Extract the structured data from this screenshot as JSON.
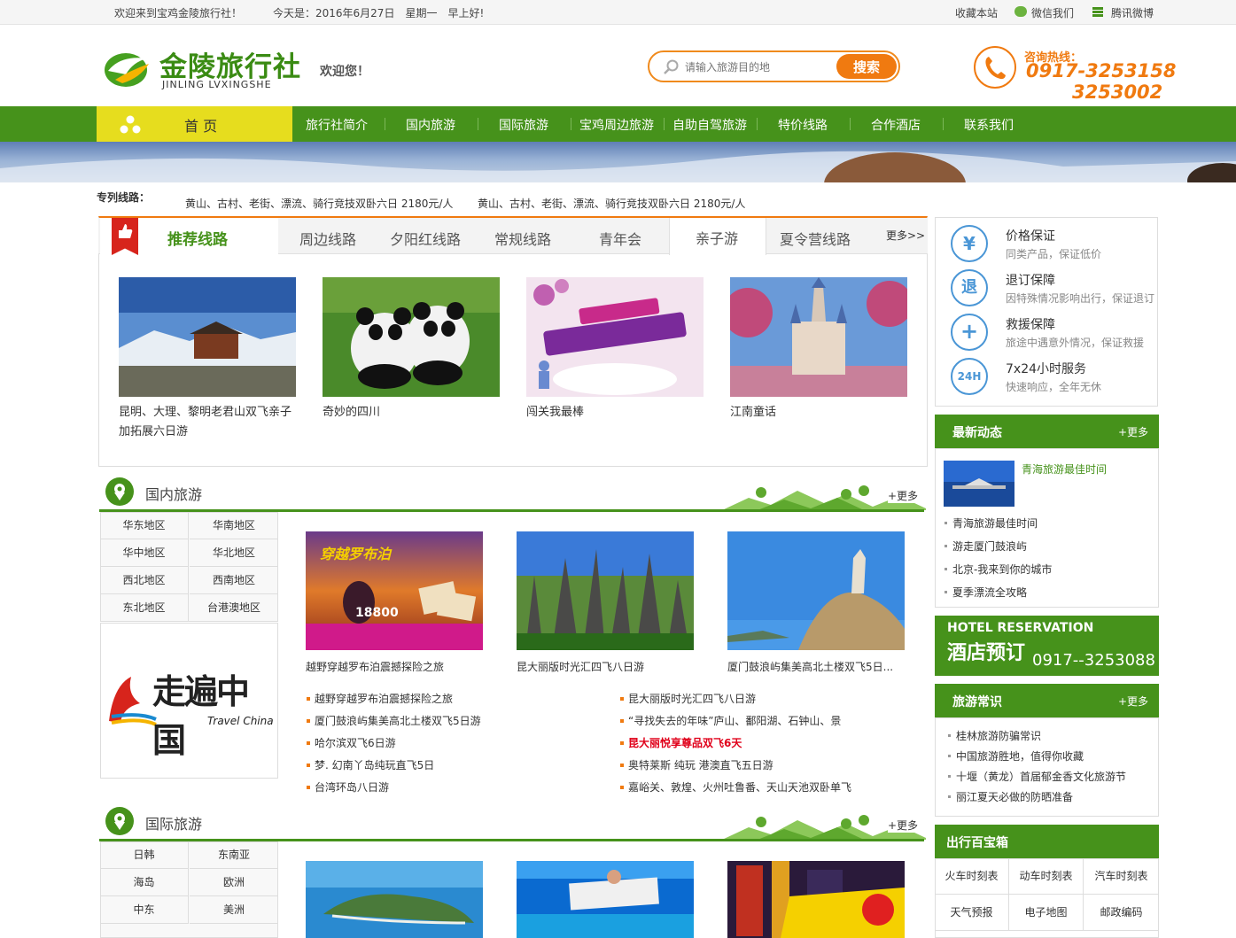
{
  "topbar": {
    "welcome": "欢迎来到宝鸡金陵旅行社！",
    "date": "今天是：2016年6月27日　星期一　早上好!",
    "favorite": "收藏本站",
    "wechat": "微信我们",
    "weibo": "腾讯微博"
  },
  "header": {
    "logo_cn": "金陵旅行社",
    "logo_en": "JINLING LVXINGSHE",
    "welcome": "欢迎您！",
    "search_placeholder": "请输入旅游目的地",
    "search_button": "搜索",
    "hotline_label": "咨询热线：",
    "hotline_1": "0917-3253158",
    "hotline_2": "3253002"
  },
  "nav": {
    "home": "首 页",
    "items": [
      "旅行社简介",
      "国内旅游",
      "国际旅游",
      "宝鸡周边旅游",
      "自助自驾旅游",
      "特价线路",
      "合作酒店",
      "联系我们"
    ]
  },
  "special": {
    "label": "专列线路：",
    "items": [
      "黄山、古村、老街、漂流、骑行竞技双卧六日 2180元/人",
      "黄山、古村、老街、漂流、骑行竞技双卧六日 2180元/人"
    ]
  },
  "recommend": {
    "title": "推荐线路",
    "tabs": [
      "周边线路",
      "夕阳红线路",
      "常规线路",
      "青年会",
      "亲子游",
      "夏令营线路"
    ],
    "more": "更多>>",
    "cards": [
      {
        "title": "昆明、大理、黎明老君山双飞亲子加拓展六日游"
      },
      {
        "title": "奇妙的四川"
      },
      {
        "title": "闯关我最棒"
      },
      {
        "title": "江南童话"
      }
    ]
  },
  "domestic": {
    "title": "国内旅游",
    "more": "+更多",
    "regions": [
      "华东地区",
      "华南地区",
      "华中地区",
      "华北地区",
      "西北地区",
      "西南地区",
      "东北地区",
      "台港澳地区"
    ],
    "ad_text": "走遍中国",
    "ad_sub": "Travel China",
    "cards": [
      {
        "caption": "越野穿越罗布泊震撼探险之旅",
        "img_text": "穿越罗布泊",
        "price": "18800"
      },
      {
        "caption": "昆大丽版时光汇四飞八日游"
      },
      {
        "caption": "厦门鼓浪屿集美高北土楼双飞5日..."
      }
    ],
    "list_left": [
      "越野穿越罗布泊震撼探险之旅",
      "厦门鼓浪屿集美高北土楼双飞5日游",
      "哈尔滨双飞6日游",
      "梦. 幻南丫岛纯玩直飞5日",
      "台湾环岛八日游"
    ],
    "list_right": [
      "昆大丽版时光汇四飞八日游",
      "“寻找失去的年味”庐山、鄱阳湖、石钟山、景",
      "昆大丽悦享尊品双飞6天",
      "奥特莱斯 纯玩 港澳直飞五日游",
      "嘉峪关、敦煌、火州吐鲁番、天山天池双卧单飞"
    ]
  },
  "international": {
    "title": "国际旅游",
    "more": "+更多",
    "regions": [
      "日韩",
      "东南亚",
      "海岛",
      "欧洲",
      "中东",
      "美洲"
    ]
  },
  "guarantee": [
    {
      "icon": "¥",
      "title": "价格保证",
      "sub": "同类产品，保证低价"
    },
    {
      "icon": "退",
      "title": "退订保障",
      "sub": "因特殊情况影响出行，保证退订"
    },
    {
      "icon": "+",
      "title": "救援保障",
      "sub": "旅途中遇意外情况，保证救援"
    },
    {
      "icon": "24H",
      "title": "7x24小时服务",
      "sub": "快速响应，全年无休"
    }
  ],
  "news": {
    "title": "最新动态",
    "more": "+更多",
    "featured": "青海旅游最佳时间",
    "items": [
      "青海旅游最佳时间",
      "游走厦门鼓浪屿",
      "北京-我来到你的城市",
      "夏季漂流全攻略"
    ]
  },
  "hotel": {
    "en": "HOTEL RESERVATION",
    "cn": "酒店预订",
    "phone": "0917--3253088"
  },
  "knowledge": {
    "title": "旅游常识",
    "more": "+更多",
    "items": [
      "桂林旅游防骗常识",
      "中国旅游胜地，值得你收藏",
      "十堰（黄龙）首届郁金香文化旅游节",
      "丽江夏天必做的防晒准备"
    ]
  },
  "toolbox": {
    "title": "出行百宝箱",
    "items": [
      "火车时刻表",
      "动车时刻表",
      "汽车时刻表",
      "天气预报",
      "电子地图",
      "邮政编码"
    ]
  },
  "colors": {
    "brand_green": "#46921b",
    "accent_orange": "#f07a10",
    "nav_yellow": "#e6dd1e"
  }
}
